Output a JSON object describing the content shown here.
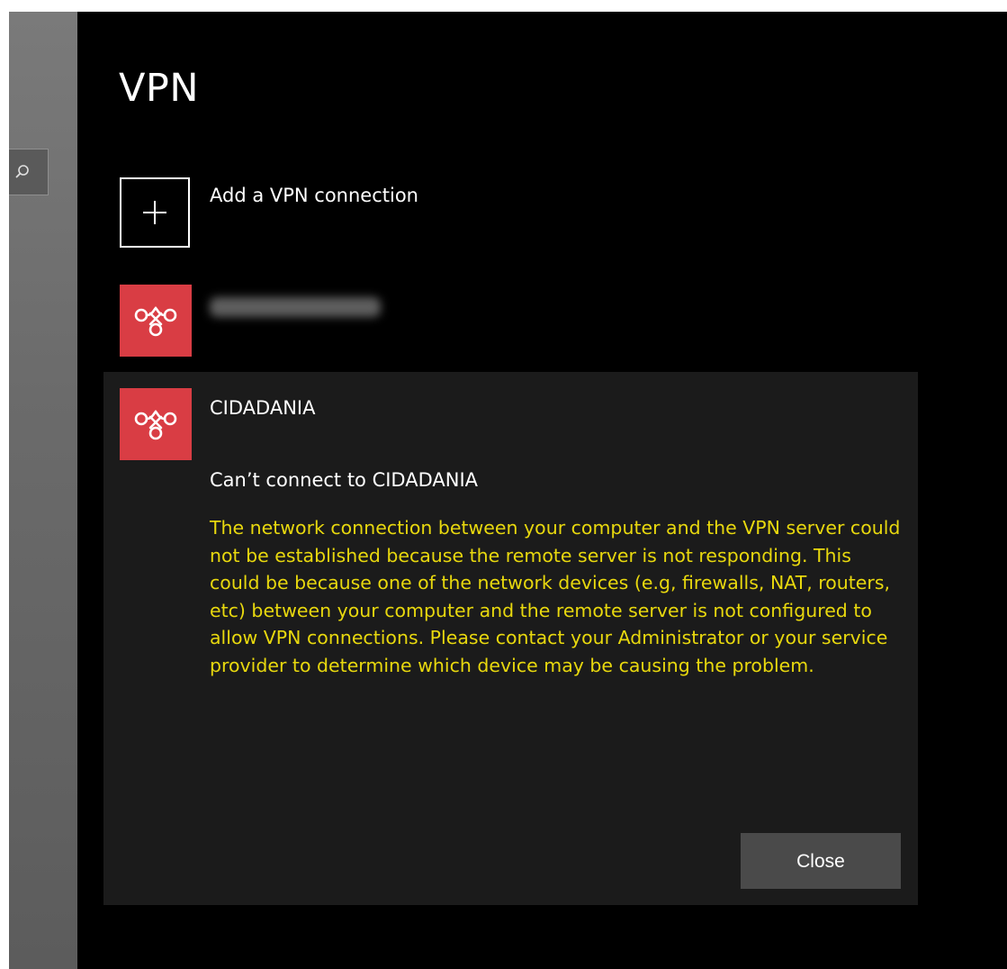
{
  "page": {
    "title": "VPN"
  },
  "add_connection": {
    "label": "Add a VPN connection",
    "icon": "plus-icon"
  },
  "connections": [
    {
      "name": "",
      "redacted": true,
      "logo_color": "#d93d44",
      "icon": "vpn-knot-icon"
    },
    {
      "name": "CIDADANIA",
      "logo_color": "#d93d44",
      "icon": "vpn-knot-icon"
    }
  ],
  "error": {
    "title": "Can’t connect to CIDADANIA",
    "message": "The network connection between your computer and the VPN server could not be established because the remote server is not responding. This could be because one of the network devices (e.g, firewalls, NAT, routers, etc) between your computer and the remote server is not configured to allow VPN connections. Please contact your Administrator or your service provider to determine which device may be causing the problem.",
    "message_color": "#e8d80e",
    "close_label": "Close"
  },
  "sidebar": {
    "search_icon": "search-icon"
  }
}
